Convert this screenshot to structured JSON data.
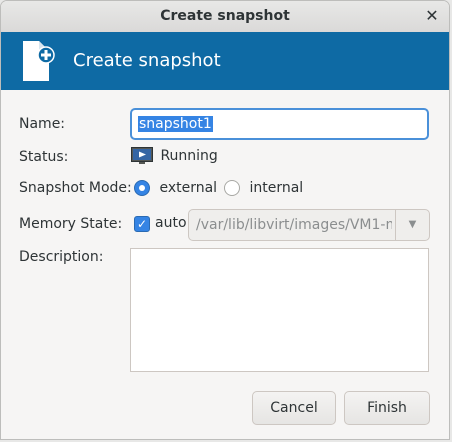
{
  "window": {
    "title": "Create snapshot",
    "close_glyph": "✕"
  },
  "banner": {
    "title": "Create snapshot",
    "icon": "snapshot-add-icon"
  },
  "form": {
    "name_label": "Name:",
    "name_value": "snapshot1",
    "status_label": "Status:",
    "status_value": "Running",
    "mode_label": "Snapshot Mode:",
    "mode_options": [
      "external",
      "internal"
    ],
    "mode_selected": "external",
    "memory_label": "Memory State:",
    "memory_auto_label": "auto",
    "memory_auto_checked": true,
    "memory_path": "/var/lib/libvirt/images/VM1-m",
    "description_label": "Description:",
    "description_value": ""
  },
  "buttons": {
    "cancel": "Cancel",
    "finish": "Finish"
  },
  "colors": {
    "banner": "#0e6aa4",
    "accent": "#3584e4"
  }
}
